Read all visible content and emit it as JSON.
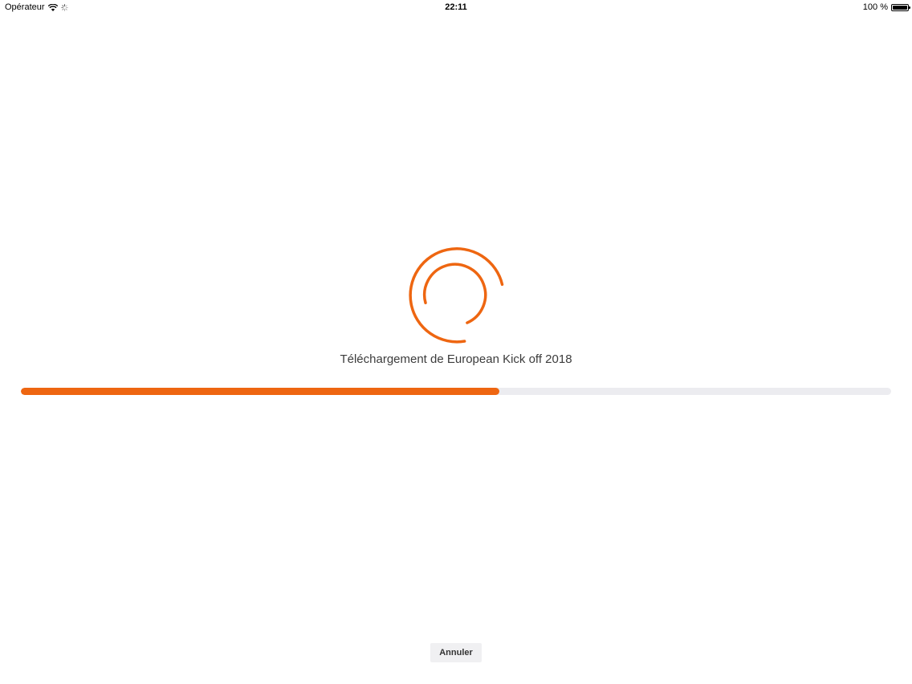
{
  "status_bar": {
    "carrier": "Opérateur",
    "time": "22:11",
    "battery_text": "100 %",
    "battery_level": 1.0,
    "icons": [
      "wifi-icon",
      "activity-icon",
      "battery-icon"
    ]
  },
  "download": {
    "label": "Téléchargement de European Kick off 2018",
    "progress": 0.55
  },
  "actions": {
    "cancel_label": "Annuler"
  },
  "colors": {
    "accent": "#ee6611",
    "track": "#ececf0",
    "background": "#ffffff"
  }
}
